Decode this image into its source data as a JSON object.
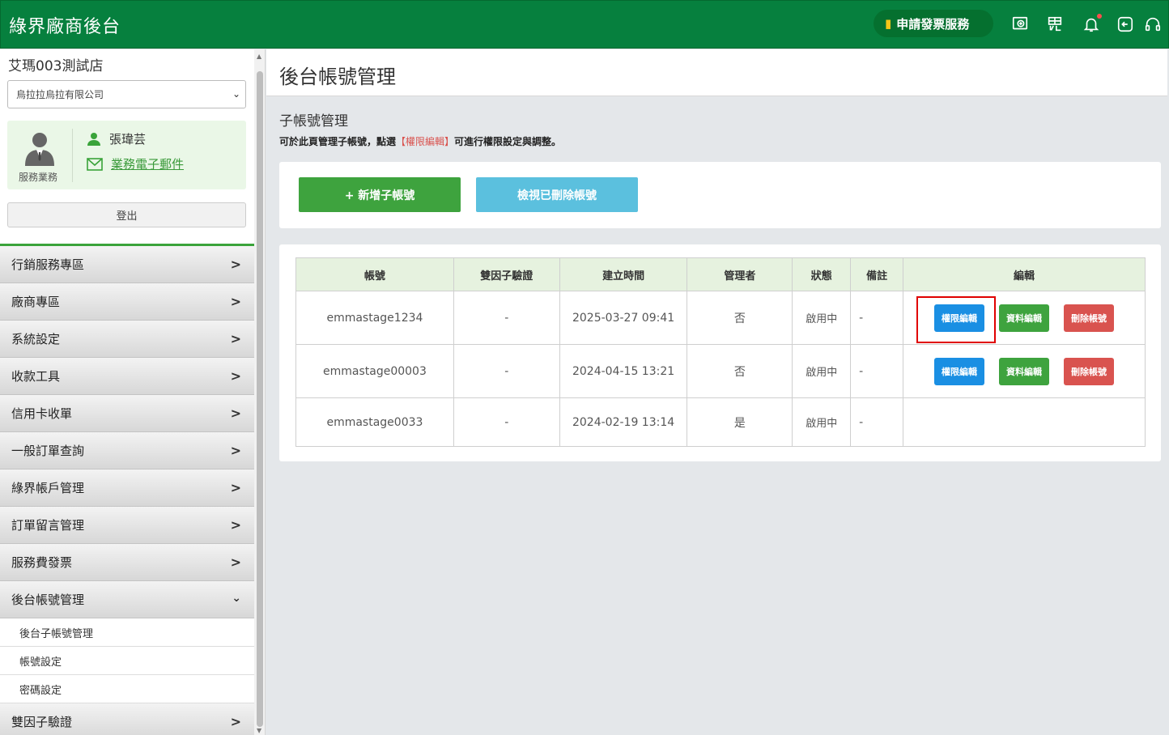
{
  "header": {
    "brand": "綠界廠商後台",
    "invoice_service": "申請發票服務"
  },
  "sidebar": {
    "store_name": "艾瑪003測試店",
    "company": "烏拉拉烏拉有限公司",
    "agent": {
      "role": "服務業務",
      "name": "張瑋芸",
      "email_link": "業務電子郵件"
    },
    "logout": "登出",
    "menu": [
      "行銷服務專區",
      "廠商專區",
      "系統設定",
      "收款工具",
      "信用卡收單",
      "一般訂單查詢",
      "綠界帳戶管理",
      "訂單留言管理",
      "服務費發票",
      "後台帳號管理"
    ],
    "submenu": [
      "後台子帳號管理",
      "帳號設定",
      "密碼設定"
    ],
    "after_menu": "雙因子驗證"
  },
  "page": {
    "title": "後台帳號管理",
    "section_title": "子帳號管理",
    "desc_before": "可於此頁管理子帳號，點選",
    "desc_highlight": "【權限編輯】",
    "desc_after": "可進行權限設定與調整。",
    "add_button": "+ 新增子帳號",
    "view_deleted_button": "檢視已刪除帳號"
  },
  "table": {
    "headers": [
      "帳號",
      "雙因子驗證",
      "建立時間",
      "管理者",
      "狀態",
      "備註",
      "編輯"
    ],
    "rows": [
      {
        "account": "emmastage1234",
        "two_factor": "-",
        "created": "2025-03-27 09:41",
        "admin": "否",
        "status": "啟用中",
        "note": "-"
      },
      {
        "account": "emmastage00003",
        "two_factor": "-",
        "created": "2024-04-15 13:21",
        "admin": "否",
        "status": "啟用中",
        "note": "-"
      },
      {
        "account": "emmastage0033",
        "two_factor": "-",
        "created": "2024-02-19 13:14",
        "admin": "是",
        "status": "啟用中",
        "note": "-"
      }
    ],
    "ops": {
      "perm": "權限編輯",
      "info": "資料編輯",
      "delete": "刪除帳號"
    }
  }
}
